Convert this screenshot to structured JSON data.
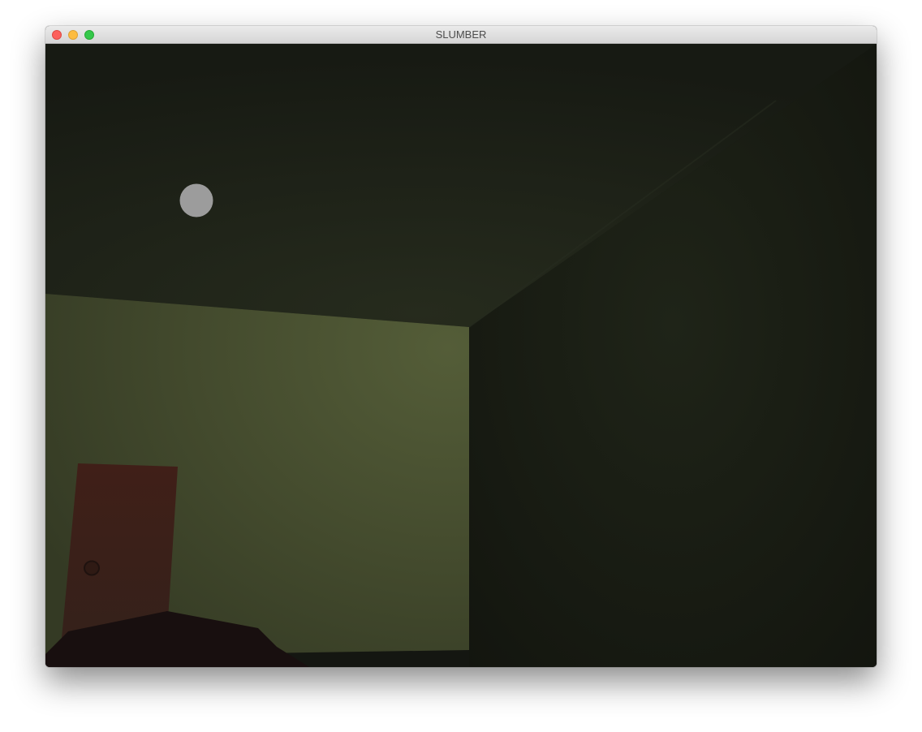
{
  "window": {
    "title": "SLUMBER"
  },
  "scene": {
    "ceiling_color": "#20241a",
    "left_wall_color": "#4b5433",
    "right_wall_color": "#1c2016",
    "floor_color": "#141611",
    "door_color": "#3d1e18",
    "bed_color": "#180f0f",
    "moon_color": "#9c9c9c"
  },
  "icons": {
    "close": "close-button-icon",
    "minimize": "minimize-button-icon",
    "zoom": "zoom-button-icon"
  }
}
